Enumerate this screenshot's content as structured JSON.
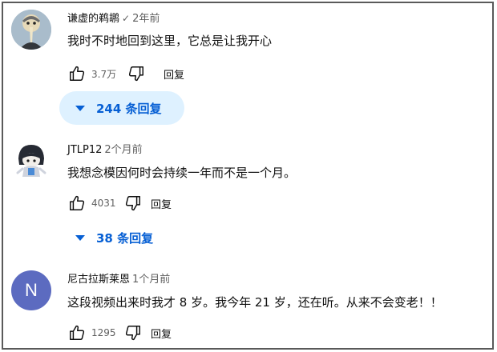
{
  "comments": [
    {
      "author": "谦虚的鹈鹕",
      "verified_mark": "✓",
      "time": "2年前",
      "text": "我时不时地回到这里，它总是让我开心",
      "likes": "3.7万",
      "reply_label": "回复",
      "replies_label": "244 条回复",
      "avatar_icon": "pelican-avatar-icon"
    },
    {
      "author": "JTLP12",
      "time": "2个月前",
      "text": "我想念模因何时会持续一年而不是一个月。",
      "likes": "4031",
      "reply_label": "回复",
      "replies_label": "38 条回复",
      "avatar_icon": "chibi-character-avatar-icon"
    },
    {
      "author": "尼古拉斯莱恩",
      "time": "1个月前",
      "text": "这段视频出来时我才 8 岁。我今年 21 岁，还在听。从来不会变老！！",
      "likes": "1295",
      "reply_label": "回复",
      "avatar_letter": "N",
      "avatar_color": "#5c6bc0"
    }
  ],
  "colors": {
    "accent": "#065fd4",
    "pill_bg": "#def1ff",
    "secondary_text": "#606060"
  }
}
